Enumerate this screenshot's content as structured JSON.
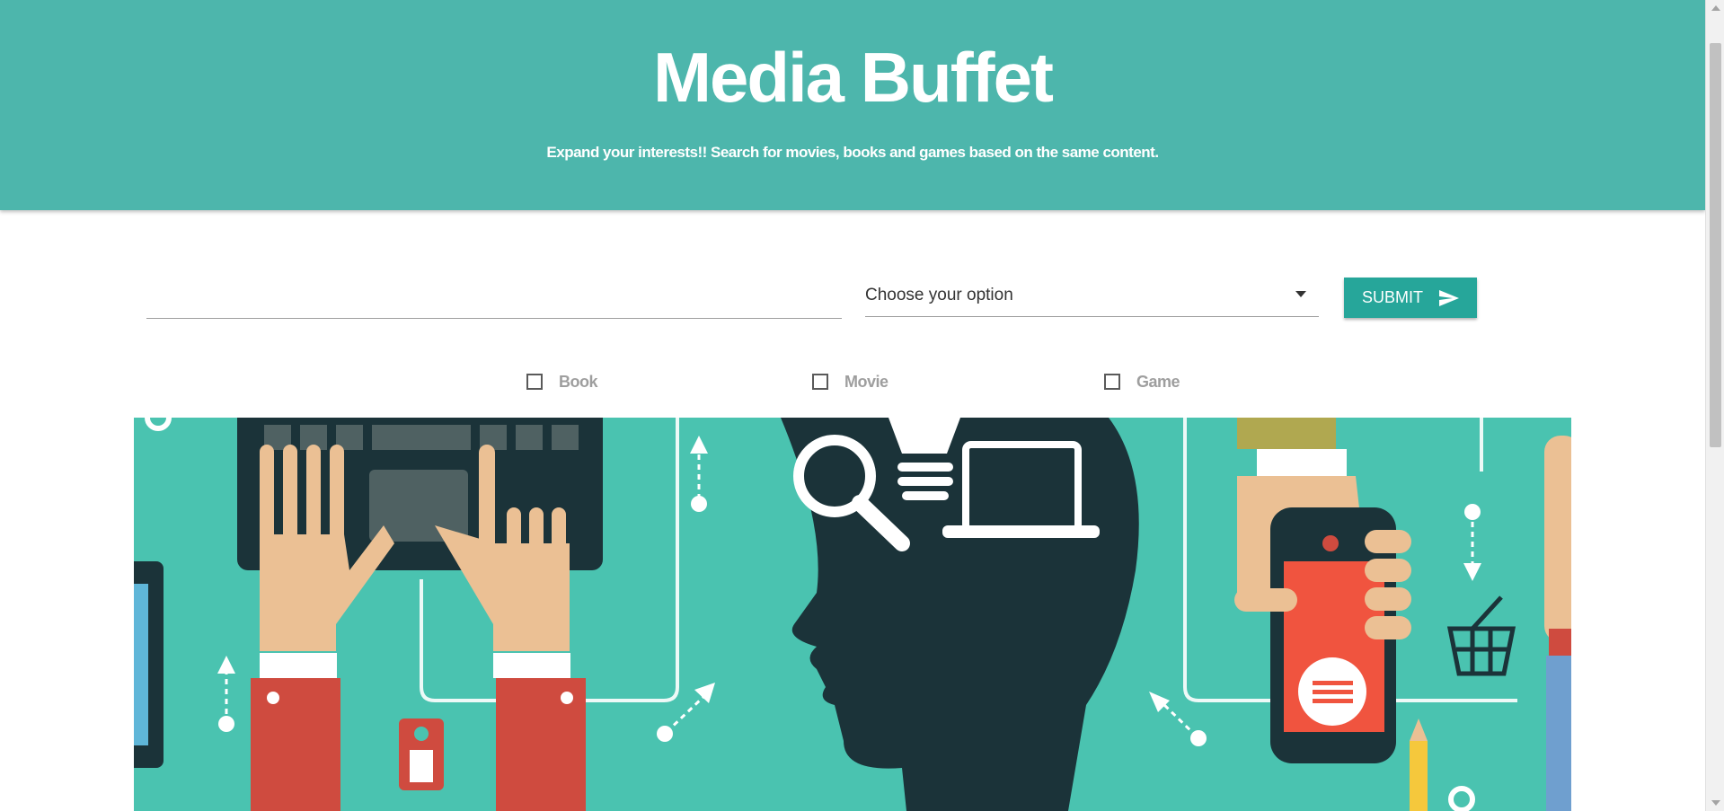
{
  "header": {
    "title": "Media Buffet",
    "subtitle": "Expand your interests!! Search for movies, books and games based on the same content."
  },
  "search": {
    "value": "",
    "placeholder": ""
  },
  "select": {
    "selected": "Choose your option"
  },
  "submit": {
    "label": "SUBMIT",
    "icon": "send-icon"
  },
  "filters": [
    {
      "label": "Book",
      "checked": false
    },
    {
      "label": "Movie",
      "checked": false
    },
    {
      "label": "Game",
      "checked": false
    }
  ],
  "colors": {
    "header": "#4db6ac",
    "button": "#26a69a",
    "banner": "#4ac3b0",
    "dark": "#1b3339",
    "skin": "#ebc094",
    "sleeve": "#cf4b3f",
    "phone": "#f0543f"
  }
}
